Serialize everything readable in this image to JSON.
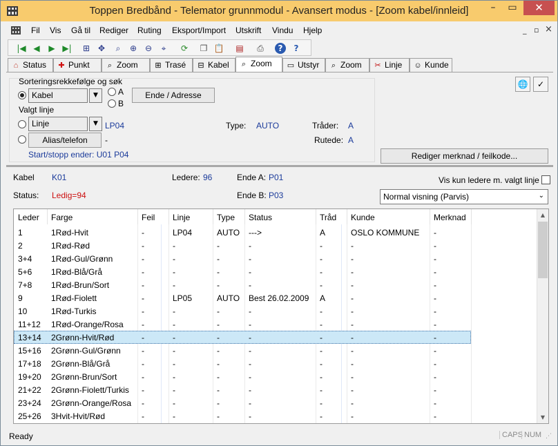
{
  "window": {
    "title": "Toppen Bredbånd - Telemator grunnmodul - Avansert modus - [Zoom kabel/innleid]",
    "min_glyph": "–",
    "max_glyph": "▭",
    "close_glyph": "✕",
    "app_icon": "telemator-app-icon"
  },
  "menu": {
    "items": [
      "Fil",
      "Vis",
      "Gå til",
      "Rediger",
      "Ruting",
      "Eksport/Import",
      "Utskrift",
      "Vindu",
      "Hjelp"
    ],
    "mdi_min": "_",
    "mdi_restore": "▫",
    "mdi_close": "×"
  },
  "toolbar": {
    "buttons": [
      {
        "icon": "first-icon",
        "glyph": "|◀"
      },
      {
        "icon": "prev-icon",
        "glyph": "◀"
      },
      {
        "icon": "next-icon",
        "glyph": "▶"
      },
      {
        "icon": "last-icon",
        "glyph": "▶|"
      },
      {
        "icon": "tree-icon",
        "glyph": "⊞"
      },
      {
        "icon": "move-icon",
        "glyph": "✥"
      },
      {
        "icon": "zoom-window-icon",
        "glyph": "⌕"
      },
      {
        "icon": "zoom-in-icon",
        "glyph": "⊕"
      },
      {
        "icon": "zoom-out-icon",
        "glyph": "⊖"
      },
      {
        "icon": "zoom-fit-icon",
        "glyph": "⌖"
      },
      {
        "icon": "refresh-icon",
        "glyph": "⟳"
      },
      {
        "icon": "copy-icon",
        "glyph": "❐"
      },
      {
        "icon": "paste-icon",
        "glyph": "📋"
      },
      {
        "icon": "barcode-icon",
        "glyph": "▤"
      },
      {
        "icon": "print-icon",
        "glyph": "⎙"
      },
      {
        "icon": "help-icon",
        "glyph": "?"
      },
      {
        "icon": "context-help-icon",
        "glyph": "?"
      }
    ]
  },
  "tabs": [
    {
      "label": "Status",
      "icon": "house-icon",
      "glyph": "⌂",
      "active": false
    },
    {
      "label": "Punkt",
      "icon": "point-icon",
      "glyph": "✚",
      "active": false
    },
    {
      "label": "Zoom",
      "icon": "zoom-point-icon",
      "glyph": "⌕",
      "active": false
    },
    {
      "label": "Trasé",
      "icon": "route-icon",
      "glyph": "⊞",
      "active": false
    },
    {
      "label": "Kabel",
      "icon": "cable-icon",
      "glyph": "⊟",
      "active": false
    },
    {
      "label": "Zoom",
      "icon": "zoom-cable-icon",
      "glyph": "⌕",
      "active": true
    },
    {
      "label": "Utstyr",
      "icon": "equipment-icon",
      "glyph": "▭",
      "active": false
    },
    {
      "label": "Zoom",
      "icon": "zoom-equipment-icon",
      "glyph": "⌕",
      "active": false
    },
    {
      "label": "Linje",
      "icon": "line-icon",
      "glyph": "✂",
      "active": false
    },
    {
      "label": "Kunde",
      "icon": "customer-icon",
      "glyph": "☺",
      "active": false
    }
  ],
  "sort_panel": {
    "title": "Sorteringsrekkefølge og søk",
    "sort_combo": "Kabel",
    "radio_a": "A",
    "radio_b": "B",
    "ende_button": "Ende / Adresse",
    "valgt_linje_label": "Valgt linje",
    "linje_combo": "Linje",
    "linje_value": "LP04",
    "alias_button": "Alias/telefon",
    "alias_value": "-",
    "type_label": "Type:",
    "type_value": "AUTO",
    "trader_label": "Tråder:",
    "trader_value": "A",
    "rutede_label": "Rutede:",
    "rutede_value": "A",
    "start_stop": "Start/stopp ender: U01  P04",
    "rediger_button": "Rediger merknad / feilkode...",
    "combo_arrow": "▼"
  },
  "cable_info": {
    "kabel_label": "Kabel",
    "kabel_value": "K01",
    "ledere_label": "Ledere:",
    "ledere_value": "96",
    "ende_a_label": "Ende A:",
    "ende_a_value": "P01",
    "status_label": "Status:",
    "status_value": "Ledig=94",
    "ende_b_label": "Ende B:",
    "ende_b_value": "P03",
    "vis_kun_label": "Vis kun ledere m. valgt linje",
    "view_combo": "Normal visning (Parvis)"
  },
  "grid": {
    "columns": [
      "Leder",
      "Farge",
      "Feil",
      "Linje",
      "Type",
      "Status",
      "Tråd",
      "Kunde",
      "Merknad"
    ],
    "sort_glyph": "^",
    "rows": [
      [
        "1",
        "1Rød-Hvit",
        "-",
        "LP04",
        "AUTO",
        "--->",
        "A",
        "OSLO KOMMUNE",
        "-"
      ],
      [
        "2",
        "1Rød-Rød",
        "-",
        "-",
        "-",
        "-",
        "-",
        "-",
        "-"
      ],
      [
        "3+4",
        "1Rød-Gul/Grønn",
        "-",
        "-",
        "-",
        "-",
        "-",
        "-",
        "-"
      ],
      [
        "5+6",
        "1Rød-Blå/Grå",
        "-",
        "-",
        "-",
        "-",
        "-",
        "-",
        "-"
      ],
      [
        "7+8",
        "1Rød-Brun/Sort",
        "-",
        "-",
        "-",
        "-",
        "-",
        "-",
        "-"
      ],
      [
        "9",
        "1Rød-Fiolett",
        "-",
        "LP05",
        "AUTO",
        "Best 26.02.2009",
        "A",
        "-",
        "-"
      ],
      [
        "10",
        "1Rød-Turkis",
        "-",
        "-",
        "-",
        "-",
        "-",
        "-",
        "-"
      ],
      [
        "11+12",
        "1Rød-Orange/Rosa",
        "-",
        "-",
        "-",
        "-",
        "-",
        "-",
        "-"
      ],
      [
        "13+14",
        "2Grønn-Hvit/Rød",
        "-",
        "-",
        "-",
        "-",
        "-",
        "-",
        "-"
      ],
      [
        "15+16",
        "2Grønn-Gul/Grønn",
        "-",
        "-",
        "-",
        "-",
        "-",
        "-",
        "-"
      ],
      [
        "17+18",
        "2Grønn-Blå/Grå",
        "-",
        "-",
        "-",
        "-",
        "-",
        "-",
        "-"
      ],
      [
        "19+20",
        "2Grønn-Brun/Sort",
        "-",
        "-",
        "-",
        "-",
        "-",
        "-",
        "-"
      ],
      [
        "21+22",
        "2Grønn-Fiolett/Turkis",
        "-",
        "-",
        "-",
        "-",
        "-",
        "-",
        "-"
      ],
      [
        "23+24",
        "2Grønn-Orange/Rosa",
        "-",
        "-",
        "-",
        "-",
        "-",
        "-",
        "-"
      ],
      [
        "25+26",
        "3Hvit-Hvit/Rød",
        "-",
        "-",
        "-",
        "-",
        "-",
        "-",
        "-"
      ]
    ],
    "selected_row": "13+14"
  },
  "statusbar": {
    "ready": "Ready",
    "caps": "CAPS",
    "num": "NUM",
    "grip": "⋰"
  },
  "colors": {
    "title_bg": "#f8cb6d",
    "close_bg": "#c75050",
    "selection": "#cce8f7",
    "link_blue": "#1a3a9a",
    "status_red": "#cc1010"
  }
}
